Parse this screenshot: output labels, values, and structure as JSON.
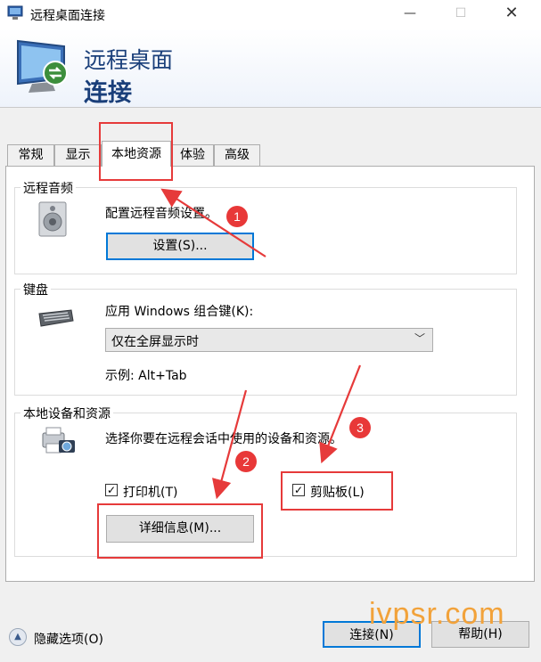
{
  "window": {
    "title": "远程桌面连接",
    "controls": {
      "minimize": "—",
      "maximize": "☐",
      "close": "✕"
    }
  },
  "banner": {
    "line1": "远程桌面",
    "line2": "连接"
  },
  "tabs": [
    {
      "label": "常规"
    },
    {
      "label": "显示"
    },
    {
      "label": "本地资源",
      "active": true
    },
    {
      "label": "体验"
    },
    {
      "label": "高级"
    }
  ],
  "audio": {
    "group_title": "远程音频",
    "description": "配置远程音频设置。",
    "settings_button": "设置(S)..."
  },
  "keyboard": {
    "group_title": "键盘",
    "label": "应用 Windows 组合键(K):",
    "selected": "仅在全屏显示时",
    "example": "示例: Alt+Tab"
  },
  "devices": {
    "group_title": "本地设备和资源",
    "description": "选择你要在远程会话中使用的设备和资源。",
    "printer": {
      "label": "打印机(T)",
      "checked": true
    },
    "clipboard": {
      "label": "剪贴板(L)",
      "checked": true
    },
    "details_button": "详细信息(M)..."
  },
  "annotations": {
    "badge1": "1",
    "badge2": "2",
    "badge3": "3"
  },
  "watermark": "ivpsr.com",
  "footer": {
    "hide_options": "隐藏选项(O)",
    "connect_button": "连接(N)",
    "help_button": "帮助(H)"
  },
  "colors": {
    "accent": "#0078d7",
    "annotation_red": "#e63a3a",
    "banner_text": "#1a3f7a",
    "watermark": "#f2a23a"
  }
}
